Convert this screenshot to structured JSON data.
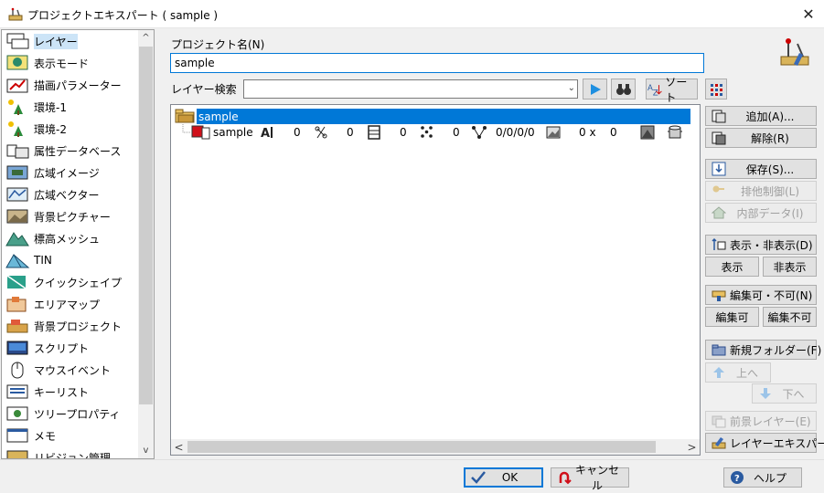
{
  "window": {
    "title": "プロジェクトエキスパート ( sample )",
    "close_glyph": "✕"
  },
  "sidebar": {
    "items": [
      {
        "label": "レイヤー",
        "icon": "layer-icon",
        "selected": true
      },
      {
        "label": "表示モード",
        "icon": "display-mode-icon"
      },
      {
        "label": "描画パラメーター",
        "icon": "draw-params-icon"
      },
      {
        "label": "環境-1",
        "icon": "environment-icon"
      },
      {
        "label": "環境-2",
        "icon": "environment-icon"
      },
      {
        "label": "属性データベース",
        "icon": "attribute-db-icon"
      },
      {
        "label": "広域イメージ",
        "icon": "wide-image-icon"
      },
      {
        "label": "広域ベクター",
        "icon": "wide-vector-icon"
      },
      {
        "label": "背景ピクチャー",
        "icon": "background-picture-icon"
      },
      {
        "label": "標高メッシュ",
        "icon": "elevation-mesh-icon"
      },
      {
        "label": "TIN",
        "icon": "tin-icon"
      },
      {
        "label": "クイックシェイプ",
        "icon": "quick-shape-icon"
      },
      {
        "label": "エリアマップ",
        "icon": "area-map-icon"
      },
      {
        "label": "背景プロジェクト",
        "icon": "background-project-icon"
      },
      {
        "label": "スクリプト",
        "icon": "script-icon"
      },
      {
        "label": "マウスイベント",
        "icon": "mouse-icon"
      },
      {
        "label": "キーリスト",
        "icon": "key-list-icon"
      },
      {
        "label": "ツリープロパティ",
        "icon": "tree-property-icon"
      },
      {
        "label": "メモ",
        "icon": "memo-icon"
      },
      {
        "label": "リビジョン管理",
        "icon": "revision-icon"
      }
    ],
    "scroll_up": "^",
    "scroll_down": "v"
  },
  "form": {
    "project_name_label": "プロジェクト名(N)",
    "project_name_value": "sample",
    "layer_search_label": "レイヤー検索",
    "layer_search_value": "",
    "sort_label": "ソート"
  },
  "tree": {
    "root_label": "sample",
    "child": {
      "name": "sample",
      "counts": [
        "0",
        "0",
        "0",
        "0",
        "0/0/0/0",
        "0 x",
        "0"
      ]
    }
  },
  "actions": {
    "add": "追加(A)...",
    "remove": "解除(R)",
    "save": "保存(S)...",
    "exclusive": "排他制御(L)",
    "internal_data": "内部データ(I)",
    "show_hide": "表示・非表示(D)",
    "show": "表示",
    "hide": "非表示",
    "edit_toggle": "編集可・不可(N)",
    "editable": "編集可",
    "not_editable": "編集不可",
    "new_folder": "新規フォルダー(F)",
    "up": "上へ",
    "down": "下へ",
    "foreground_layer": "前景レイヤー(E)",
    "layer_expert": "レイヤーエキスパート"
  },
  "footer": {
    "ok": "OK",
    "cancel": "キャンセル",
    "help": "ヘルプ"
  },
  "colors": {
    "accent": "#0078d7",
    "selection_light": "#cce4f7"
  }
}
